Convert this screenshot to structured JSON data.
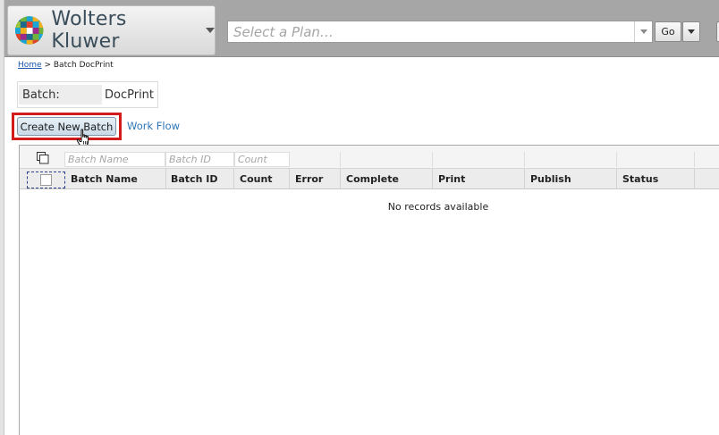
{
  "header": {
    "brand_name": "Wolters Kluwer",
    "plan_placeholder": "Select a Plan…",
    "go_label": "Go"
  },
  "breadcrumb": {
    "home": "Home",
    "separator": ">",
    "current": "Batch DocPrint"
  },
  "batch": {
    "label": "Batch:",
    "value": "DocPrint"
  },
  "actions": {
    "create_label": "Create New Batch",
    "workflow_label": "Work Flow"
  },
  "grid": {
    "filters": {
      "batch_name": "Batch Name",
      "batch_id": "Batch ID",
      "count": "Count"
    },
    "columns": [
      "Batch Name",
      "Batch ID",
      "Count",
      "Error",
      "Complete",
      "Print",
      "Publish",
      "Status"
    ],
    "empty_message": "No records available"
  },
  "colors": {
    "header_bg": "#a6a6a6",
    "highlight": "#d21c1c",
    "link": "#1a56b0",
    "workflow_link": "#2e76b8"
  }
}
